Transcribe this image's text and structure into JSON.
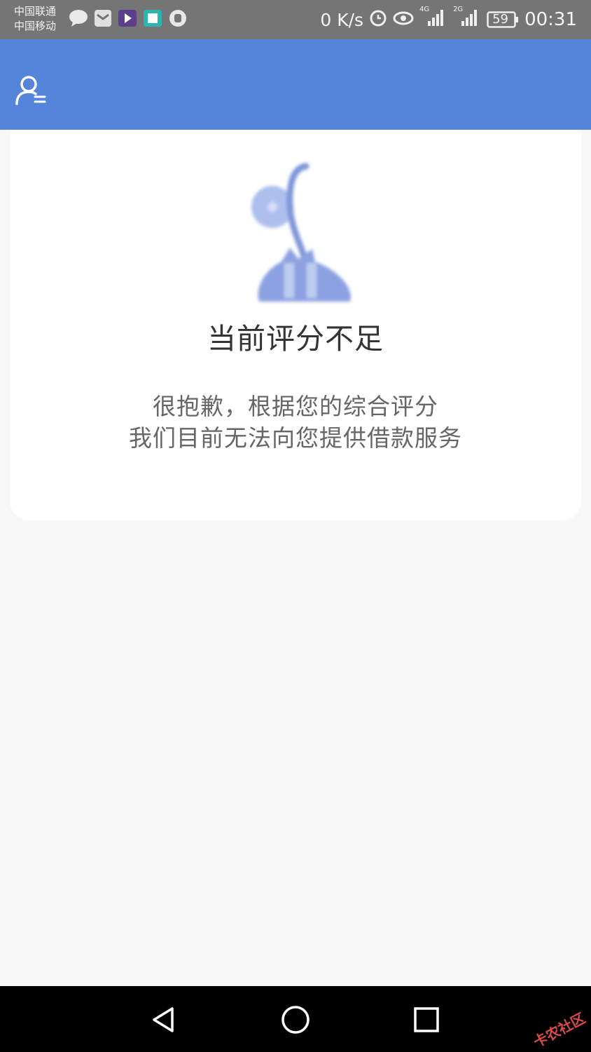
{
  "status_bar": {
    "carrier_1": "中国联通",
    "carrier_2": "中国移动",
    "net_speed": "0 K/s",
    "battery": "59",
    "network_1": "4G",
    "network_2": "2G",
    "time": "00:31",
    "icons": [
      "message-icon",
      "app-icon",
      "video-icon",
      "book-icon",
      "hand-icon",
      "alarm-icon",
      "eye-icon",
      "signal-icon",
      "signal-icon",
      "battery-icon"
    ]
  },
  "app_bar": {
    "color": "#5585db",
    "profile_icon": "user-menu-icon"
  },
  "result": {
    "title": "当前评分不足",
    "line_1": "很抱歉，根据您的综合评分",
    "line_2": "我们目前无法向您提供借款服务",
    "illustration": "lamp-illustration"
  },
  "nav_bar": {
    "buttons": [
      "back-icon",
      "home-icon",
      "recents-icon"
    ]
  },
  "watermark": "卡农社区"
}
